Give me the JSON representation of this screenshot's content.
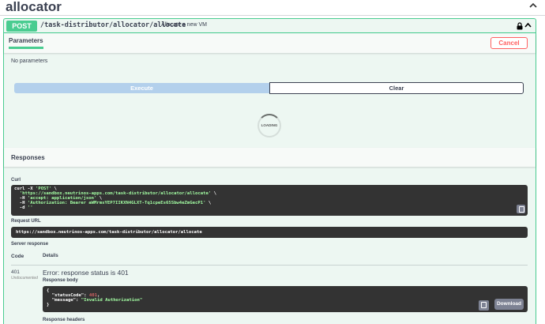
{
  "tag": {
    "title": "allocator"
  },
  "operation": {
    "method": "POST",
    "path": "/task-distributor/allocator/allocate",
    "description": "Allocate a new VM"
  },
  "parameters": {
    "tab_label": "Parameters",
    "cancel_label": "Cancel",
    "empty_text": "No parameters"
  },
  "actions": {
    "execute_label": "Execute",
    "clear_label": "Clear",
    "loading_label": "LOADING"
  },
  "responses": {
    "title": "Responses",
    "curl_label": "Curl",
    "curl_lines": [
      {
        "prefix": "curl -X ",
        "str": "'POST'",
        "suffix": " \\"
      },
      {
        "prefix": "  ",
        "str": "'https://sandbox.neutrinos-apps.com/task-distributor/allocator/allocate'",
        "suffix": " \\"
      },
      {
        "prefix": "  -H ",
        "str": "'accept: application/json'",
        "suffix": " \\"
      },
      {
        "prefix": "  -H ",
        "str": "'Authorization: Bearer aWMrmsYEP7IIKXN4GLXT-Tq1cpeEs65Sbw4eZmGecP1'",
        "suffix": " \\"
      },
      {
        "prefix": "  -d ",
        "str": "''",
        "suffix": ""
      }
    ],
    "request_url_label": "Request URL",
    "request_url": "https://sandbox.neutrinos-apps.com/task-distributor/allocator/allocate",
    "server_response_label": "Server response",
    "code_header": "Code",
    "details_header": "Details",
    "status_code": "401",
    "status_note": "Undocumented",
    "error_message": "Error: response status is 401",
    "body_label": "Response body",
    "body_lines": {
      "open": "{",
      "status_key": "  \"statusCode\": ",
      "status_value": "401",
      "message_key": "  \"message\": ",
      "message_value": "\"Invalid Authorization\"",
      "close": "}"
    },
    "download_label": "Download",
    "headers_label": "Response headers"
  },
  "colors": {
    "post_accent": "#49cc90",
    "cancel_red": "#ff6060",
    "execute_blue": "#b3d0ec",
    "code_bg": "#333333"
  },
  "icons": [
    "chevron-up-icon",
    "lock-icon",
    "copy-icon"
  ]
}
